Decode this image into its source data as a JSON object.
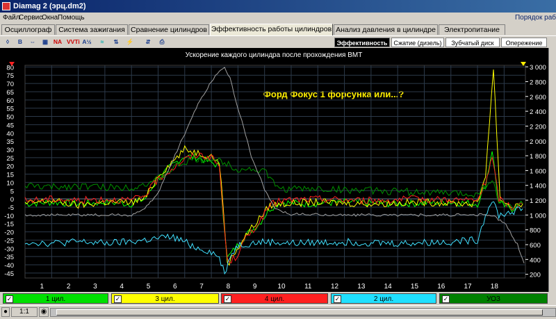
{
  "window": {
    "title": "Diamag 2 (эрц.dm2)"
  },
  "menu": {
    "items": [
      "Файл",
      "Сервис",
      "Окна",
      "Помощь"
    ],
    "right_text": "Порядок раб"
  },
  "tabs": [
    {
      "label": "Осциллограф"
    },
    {
      "label": "Система зажигания"
    },
    {
      "label": "Сравнение цилиндров"
    },
    {
      "label": "Эффективность работы цилиндров",
      "active": true
    },
    {
      "label": "Анализ давления в цилиндре"
    },
    {
      "label": "Электропитание"
    }
  ],
  "toolbar": {
    "icons": [
      "pointer-icon",
      "bold-icon",
      "ruler-icon",
      "grid-icon",
      "wave-icon",
      "wave-sharp-icon",
      "time-axis-icon",
      "scale-icon",
      "ignition-icon",
      "io-icon",
      "print-icon",
      "disk-icon"
    ],
    "labels": {
      "b": "B",
      "na": "NA",
      "vvt": "VVTi",
      "half": "A½"
    }
  },
  "subtabs": [
    {
      "label": "Эффективность",
      "active": true
    },
    {
      "label": "Сжатие (дизель)"
    },
    {
      "label": "Зубчатый диск"
    },
    {
      "label": "Опережение"
    }
  ],
  "chart_data": {
    "type": "line",
    "title": "Ускорение каждого цилиндра после прохождения ВМТ",
    "annotation": "Форд Фокус 1 форсунка или...?",
    "x_ticks": [
      1,
      2,
      3,
      4,
      5,
      6,
      7,
      8,
      9,
      10,
      11,
      12,
      13,
      14,
      15,
      16,
      17,
      18
    ],
    "xlim": [
      0,
      18.8
    ],
    "y_left": {
      "ticks": [
        80,
        75,
        70,
        65,
        60,
        55,
        50,
        45,
        40,
        35,
        30,
        25,
        20,
        15,
        10,
        5,
        0,
        -5,
        -10,
        -15,
        -20,
        -25,
        -30,
        -35,
        -40,
        -45
      ],
      "ylim": [
        -48,
        81
      ]
    },
    "y_right": {
      "ticks": [
        "3 000",
        "2 800",
        "2 600",
        "2 400",
        "2 200",
        "2 000",
        "1 800",
        "1 600",
        "1 400",
        "1 200",
        "1 000",
        "800",
        "600",
        "400",
        "200"
      ],
      "ylim": [
        150,
        3020
      ]
    },
    "grid": true,
    "series": [
      {
        "name": "1 цил.",
        "color": "#00ff00",
        "axis": "left",
        "points": [
          [
            0.0,
            -3
          ],
          [
            1.0,
            -2
          ],
          [
            2.0,
            -3
          ],
          [
            3.0,
            -2
          ],
          [
            4.0,
            -3
          ],
          [
            4.5,
            0
          ],
          [
            5.0,
            12
          ],
          [
            5.5,
            20
          ],
          [
            6.0,
            26
          ],
          [
            6.5,
            25
          ],
          [
            7.0,
            22
          ],
          [
            7.3,
            20
          ],
          [
            7.45,
            -10
          ],
          [
            7.6,
            -36
          ],
          [
            7.9,
            -30
          ],
          [
            8.3,
            -22
          ],
          [
            8.8,
            -15
          ],
          [
            9.2,
            -6
          ],
          [
            9.6,
            -2
          ],
          [
            10.5,
            -3
          ],
          [
            12.0,
            -2
          ],
          [
            14.0,
            -3
          ],
          [
            16.0,
            -2
          ],
          [
            17.0,
            -3
          ],
          [
            17.3,
            8
          ],
          [
            17.55,
            30
          ],
          [
            17.8,
            -3
          ],
          [
            18.3,
            -6
          ],
          [
            18.7,
            -3
          ]
        ]
      },
      {
        "name": "3 цил.",
        "color": "#ffff00",
        "axis": "left",
        "points": [
          [
            0.0,
            -3
          ],
          [
            1.0,
            -1
          ],
          [
            2.0,
            -4
          ],
          [
            3.0,
            -2
          ],
          [
            4.0,
            -2
          ],
          [
            4.5,
            0
          ],
          [
            5.0,
            14
          ],
          [
            5.5,
            22
          ],
          [
            6.0,
            30
          ],
          [
            6.5,
            28
          ],
          [
            7.0,
            26
          ],
          [
            7.3,
            22
          ],
          [
            7.45,
            -5
          ],
          [
            7.6,
            -40
          ],
          [
            7.9,
            -32
          ],
          [
            8.3,
            -22
          ],
          [
            8.8,
            -12
          ],
          [
            9.2,
            -4
          ],
          [
            9.6,
            -3
          ],
          [
            11.0,
            -2
          ],
          [
            13.0,
            -3
          ],
          [
            15.0,
            -2
          ],
          [
            17.0,
            -3
          ],
          [
            17.3,
            15
          ],
          [
            17.6,
            79
          ],
          [
            17.85,
            0
          ],
          [
            18.3,
            -5
          ],
          [
            18.7,
            -3
          ]
        ]
      },
      {
        "name": "4 цил.",
        "color": "#ff2020",
        "axis": "left",
        "points": [
          [
            0.0,
            -1
          ],
          [
            1.0,
            0
          ],
          [
            2.0,
            -1
          ],
          [
            3.0,
            0
          ],
          [
            4.0,
            -1
          ],
          [
            4.5,
            2
          ],
          [
            5.0,
            12
          ],
          [
            5.5,
            18
          ],
          [
            6.0,
            24
          ],
          [
            6.5,
            27
          ],
          [
            7.0,
            25
          ],
          [
            7.3,
            20
          ],
          [
            7.45,
            -10
          ],
          [
            7.6,
            -38
          ],
          [
            7.9,
            -36
          ],
          [
            8.3,
            -24
          ],
          [
            8.8,
            -14
          ],
          [
            9.2,
            -4
          ],
          [
            9.6,
            -1
          ],
          [
            11.0,
            0
          ],
          [
            13.0,
            -1
          ],
          [
            15.0,
            0
          ],
          [
            17.0,
            -1
          ],
          [
            17.3,
            10
          ],
          [
            17.55,
            25
          ],
          [
            17.8,
            0
          ],
          [
            18.3,
            -5
          ],
          [
            18.7,
            -3
          ]
        ]
      },
      {
        "name": "2 цил.",
        "color": "#40e0ff",
        "axis": "left",
        "points": [
          [
            0.0,
            -26
          ],
          [
            1.0,
            -27
          ],
          [
            2.0,
            -26
          ],
          [
            3.0,
            -27
          ],
          [
            4.0,
            -26
          ],
          [
            5.0,
            -24
          ],
          [
            5.5,
            -23
          ],
          [
            6.0,
            -26
          ],
          [
            6.5,
            -30
          ],
          [
            7.0,
            -32
          ],
          [
            7.3,
            -36
          ],
          [
            7.5,
            -45
          ],
          [
            7.7,
            -35
          ],
          [
            8.0,
            -28
          ],
          [
            8.5,
            -27
          ],
          [
            9.0,
            -26
          ],
          [
            10.0,
            -27
          ],
          [
            12.0,
            -26
          ],
          [
            14.0,
            -27
          ],
          [
            16.0,
            -26
          ],
          [
            17.0,
            -25
          ],
          [
            17.3,
            -10
          ],
          [
            17.55,
            0
          ],
          [
            17.8,
            -10
          ],
          [
            18.3,
            -8
          ],
          [
            18.7,
            -6
          ]
        ]
      },
      {
        "name": "УОЗ",
        "color": "#009000",
        "axis": "left",
        "points": [
          [
            0.0,
            8
          ],
          [
            1.0,
            7
          ],
          [
            2.0,
            8
          ],
          [
            3.0,
            7
          ],
          [
            4.0,
            7
          ],
          [
            4.5,
            9
          ],
          [
            5.0,
            12
          ],
          [
            5.5,
            18
          ],
          [
            6.0,
            22
          ],
          [
            6.5,
            24
          ],
          [
            7.0,
            24
          ],
          [
            7.5,
            22
          ],
          [
            8.0,
            18
          ],
          [
            8.5,
            18
          ],
          [
            9.0,
            17
          ],
          [
            9.4,
            8
          ],
          [
            9.7,
            6
          ],
          [
            11.0,
            6
          ],
          [
            13.0,
            5
          ],
          [
            15.0,
            4
          ],
          [
            16.5,
            3
          ],
          [
            17.0,
            3
          ],
          [
            17.3,
            8
          ],
          [
            17.55,
            12
          ],
          [
            17.8,
            -2
          ],
          [
            18.3,
            -5
          ],
          [
            18.7,
            -3
          ]
        ]
      },
      {
        "name": "",
        "color": "#a0a0a0",
        "axis": "right",
        "points": [
          [
            0.0,
            1000
          ],
          [
            1.0,
            1000
          ],
          [
            2.0,
            1000
          ],
          [
            3.0,
            1000
          ],
          [
            4.0,
            1000
          ],
          [
            4.5,
            1080
          ],
          [
            5.0,
            1300
          ],
          [
            5.5,
            1700
          ],
          [
            6.0,
            2100
          ],
          [
            6.5,
            2500
          ],
          [
            7.0,
            2800
          ],
          [
            7.3,
            2950
          ],
          [
            7.5,
            2990
          ],
          [
            7.7,
            2850
          ],
          [
            8.0,
            2450
          ],
          [
            8.5,
            1800
          ],
          [
            9.0,
            1350
          ],
          [
            9.4,
            1080
          ],
          [
            10.0,
            1010
          ],
          [
            12.0,
            1000
          ],
          [
            14.0,
            1000
          ],
          [
            16.0,
            1000
          ],
          [
            17.0,
            1000
          ],
          [
            17.5,
            1000
          ],
          [
            18.0,
            900
          ],
          [
            18.5,
            600
          ],
          [
            18.75,
            350
          ]
        ]
      }
    ]
  },
  "legend": [
    {
      "label": "1 цил.",
      "color": "#00e000"
    },
    {
      "label": "3 цил.",
      "color": "#ffff00"
    },
    {
      "label": "4 цил.",
      "color": "#ff2020"
    },
    {
      "label": "2 цил.",
      "color": "#20e0ff"
    },
    {
      "label": "УОЗ",
      "color": "#008000"
    }
  ],
  "status": {
    "zoom": "1:1"
  }
}
